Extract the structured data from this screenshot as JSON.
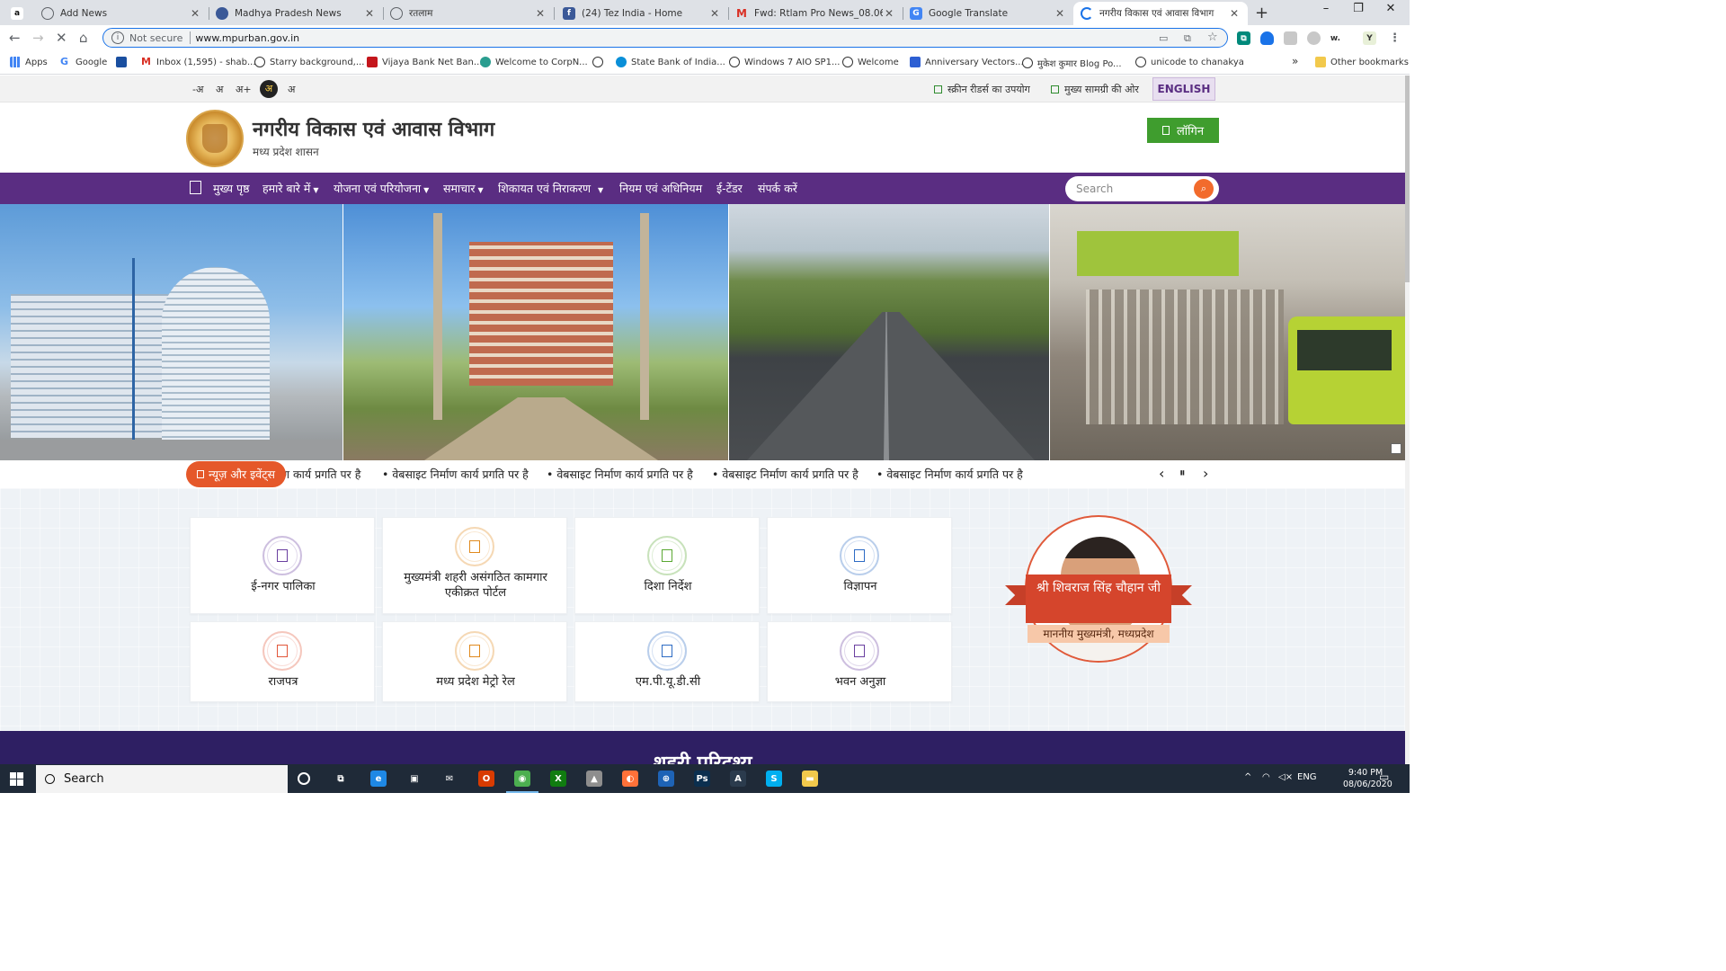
{
  "browser": {
    "tabs": [
      {
        "title": "",
        "favicon": "amazon-icon",
        "color": "#ffffff"
      },
      {
        "title": "Add News",
        "favicon": "globe-icon",
        "color": "#5f6368"
      },
      {
        "title": "Madhya Pradesh News",
        "favicon": "news-site-icon",
        "color": "#3b5998"
      },
      {
        "title": "रतलाम",
        "favicon": "globe-icon",
        "color": "#5f6368"
      },
      {
        "title": "(24) Tez India - Home",
        "favicon": "facebook-icon",
        "color": "#3b5998"
      },
      {
        "title": "Fwd: Rtlam Pro News_08.06.2020",
        "favicon": "gmail-icon",
        "color": "#d93025"
      },
      {
        "title": "Google Translate",
        "favicon": "translate-icon",
        "color": "#4285f4"
      },
      {
        "title": "नगरीय विकास एवं आवास विभाग",
        "favicon": "loading-icon",
        "color": "#1a73e8"
      }
    ],
    "new_tab": "+",
    "window_controls": [
      "–",
      "❐",
      "✕"
    ],
    "address": {
      "security_label": "Not secure",
      "url": "www.mpurban.gov.in"
    },
    "bookmarks": [
      {
        "label": "Apps",
        "icon": "apps-grid-icon",
        "color": "#4285f4"
      },
      {
        "label": "Google",
        "icon": "google-icon",
        "color": "#4285f4"
      },
      {
        "label": "",
        "icon": "bookmark-site-icon",
        "color": "#1a4fa0"
      },
      {
        "label": "Inbox (1,595) - shab...",
        "icon": "gmail-icon",
        "color": "#d93025"
      },
      {
        "label": "Starry background,...",
        "icon": "globe-icon",
        "color": "#333333"
      },
      {
        "label": "Vijaya Bank Net Ban...",
        "icon": "bank-icon",
        "color": "#c4161c"
      },
      {
        "label": "Welcome to CorpN...",
        "icon": "globe-icon",
        "color": "#2a9d8f"
      },
      {
        "label": "",
        "icon": "globe-icon",
        "color": "#333333"
      },
      {
        "label": "State Bank of India...",
        "icon": "sbi-icon",
        "color": "#0a8fd8"
      },
      {
        "label": "Windows 7 AIO SP1...",
        "icon": "globe-icon",
        "color": "#333333"
      },
      {
        "label": "Welcome",
        "icon": "globe-icon",
        "color": "#333333"
      },
      {
        "label": "Anniversary Vectors...",
        "icon": "vector-site-icon",
        "color": "#2d5fd3"
      },
      {
        "label": "मुकेश कुमार Blog Po...",
        "icon": "globe-icon",
        "color": "#333333"
      },
      {
        "label": "unicode to chanakya",
        "icon": "globe-icon",
        "color": "#333333"
      }
    ],
    "bookmarks_overflow": "»",
    "other_bookmarks": "Other bookmarks"
  },
  "site": {
    "accessibility": {
      "font_sizes": [
        "-अ",
        "अ",
        "अ+"
      ],
      "contrast_dark": "अ",
      "contrast_light": "अ",
      "screen_reader": "स्क्रीन रीडर्स का उपयोग",
      "skip_to_content": "मुख्य सामग्री की ओर",
      "language": "ENGLISH"
    },
    "header": {
      "title": "नगरीय विकास एवं आवास विभाग",
      "subtitle": "मध्य प्रदेश शासन",
      "login": "लॉगिन"
    },
    "nav": [
      {
        "label": "मुख्य पृष्ठ",
        "dropdown": false
      },
      {
        "label": "हमारे बारे में",
        "dropdown": true
      },
      {
        "label": "योजना एवं परियोजना",
        "dropdown": true
      },
      {
        "label": "समाचार",
        "dropdown": true
      },
      {
        "label": "शिकायत एवं निराकरण",
        "dropdown": true
      },
      {
        "label": "नियम एवं अधिनियम",
        "dropdown": false
      },
      {
        "label": "ई-टेंडर",
        "dropdown": false
      },
      {
        "label": "संपर्क करें",
        "dropdown": false
      }
    ],
    "search": {
      "placeholder": "Search"
    },
    "slider": {
      "slides": 2,
      "active_slide": 1
    },
    "ticker": {
      "label": "न्यूज़ और इवेंट्स",
      "first_partial": "ण कार्य प्रगति पर है",
      "items": [
        "वेबसाइट निर्माण कार्य प्रगति पर है",
        "वेबसाइट निर्माण कार्य प्रगति पर है",
        "वेबसाइट निर्माण कार्य प्रगति पर है",
        "वेबसाइट निर्माण कार्य प्रगति पर है"
      ],
      "prev": "‹",
      "pause": "⏸",
      "next": "›"
    },
    "services": [
      {
        "label": "ई-नगर पालिका",
        "color": "#6a3fa0"
      },
      {
        "label": "मुख्यमंत्री शहरी असंगठित कामगार एकीक्रत पोर्टल",
        "color": "#e08a1e"
      },
      {
        "label": "दिशा निर्देश",
        "color": "#5aa832"
      },
      {
        "label": "विज्ञापन",
        "color": "#2d6bc4"
      },
      {
        "label": "राजपत्र",
        "color": "#e2573a"
      },
      {
        "label": "मध्य प्रदेश मेट्रो रेल",
        "color": "#e08a1e"
      },
      {
        "label": "एम.पी.यू.डी.सी",
        "color": "#2d6bc4"
      },
      {
        "label": "भवन अनुज्ञा",
        "color": "#6a3fa0"
      }
    ],
    "chief_minister": {
      "name": "श्री शिवराज सिंह चौहान जी",
      "title": "माननीय मुख्यमंत्री, मध्यप्रदेश"
    },
    "next_section_heading": "शहरी परिदृश्य"
  },
  "taskbar": {
    "search_label": "Search",
    "pinned": [
      {
        "icon": "task-view-icon",
        "color": "#1f2a38"
      },
      {
        "icon": "edge-icon",
        "color": "#1e88e5"
      },
      {
        "icon": "store-icon",
        "color": "#1f2a38"
      },
      {
        "icon": "mail-icon",
        "color": "#1f2a38"
      },
      {
        "icon": "office-icon",
        "color": "#d83b01"
      },
      {
        "icon": "chrome-icon",
        "color": "#4caf50"
      },
      {
        "icon": "xbox-icon",
        "color": "#107c10"
      },
      {
        "icon": "photos-icon",
        "color": "#8e8e8e"
      },
      {
        "icon": "firefox-icon",
        "color": "#ff7139"
      },
      {
        "icon": "translator-icon",
        "color": "#1e63b6"
      },
      {
        "icon": "photoshop-icon",
        "color": "#0b2f4f"
      },
      {
        "icon": "app-a-icon",
        "color": "#2b3b4d"
      },
      {
        "icon": "skype-icon",
        "color": "#00aff0"
      },
      {
        "icon": "file-explorer-icon",
        "color": "#f2c94c"
      }
    ],
    "tray": {
      "language": "ENG",
      "time": "9:40 PM",
      "date": "08/06/2020"
    }
  }
}
